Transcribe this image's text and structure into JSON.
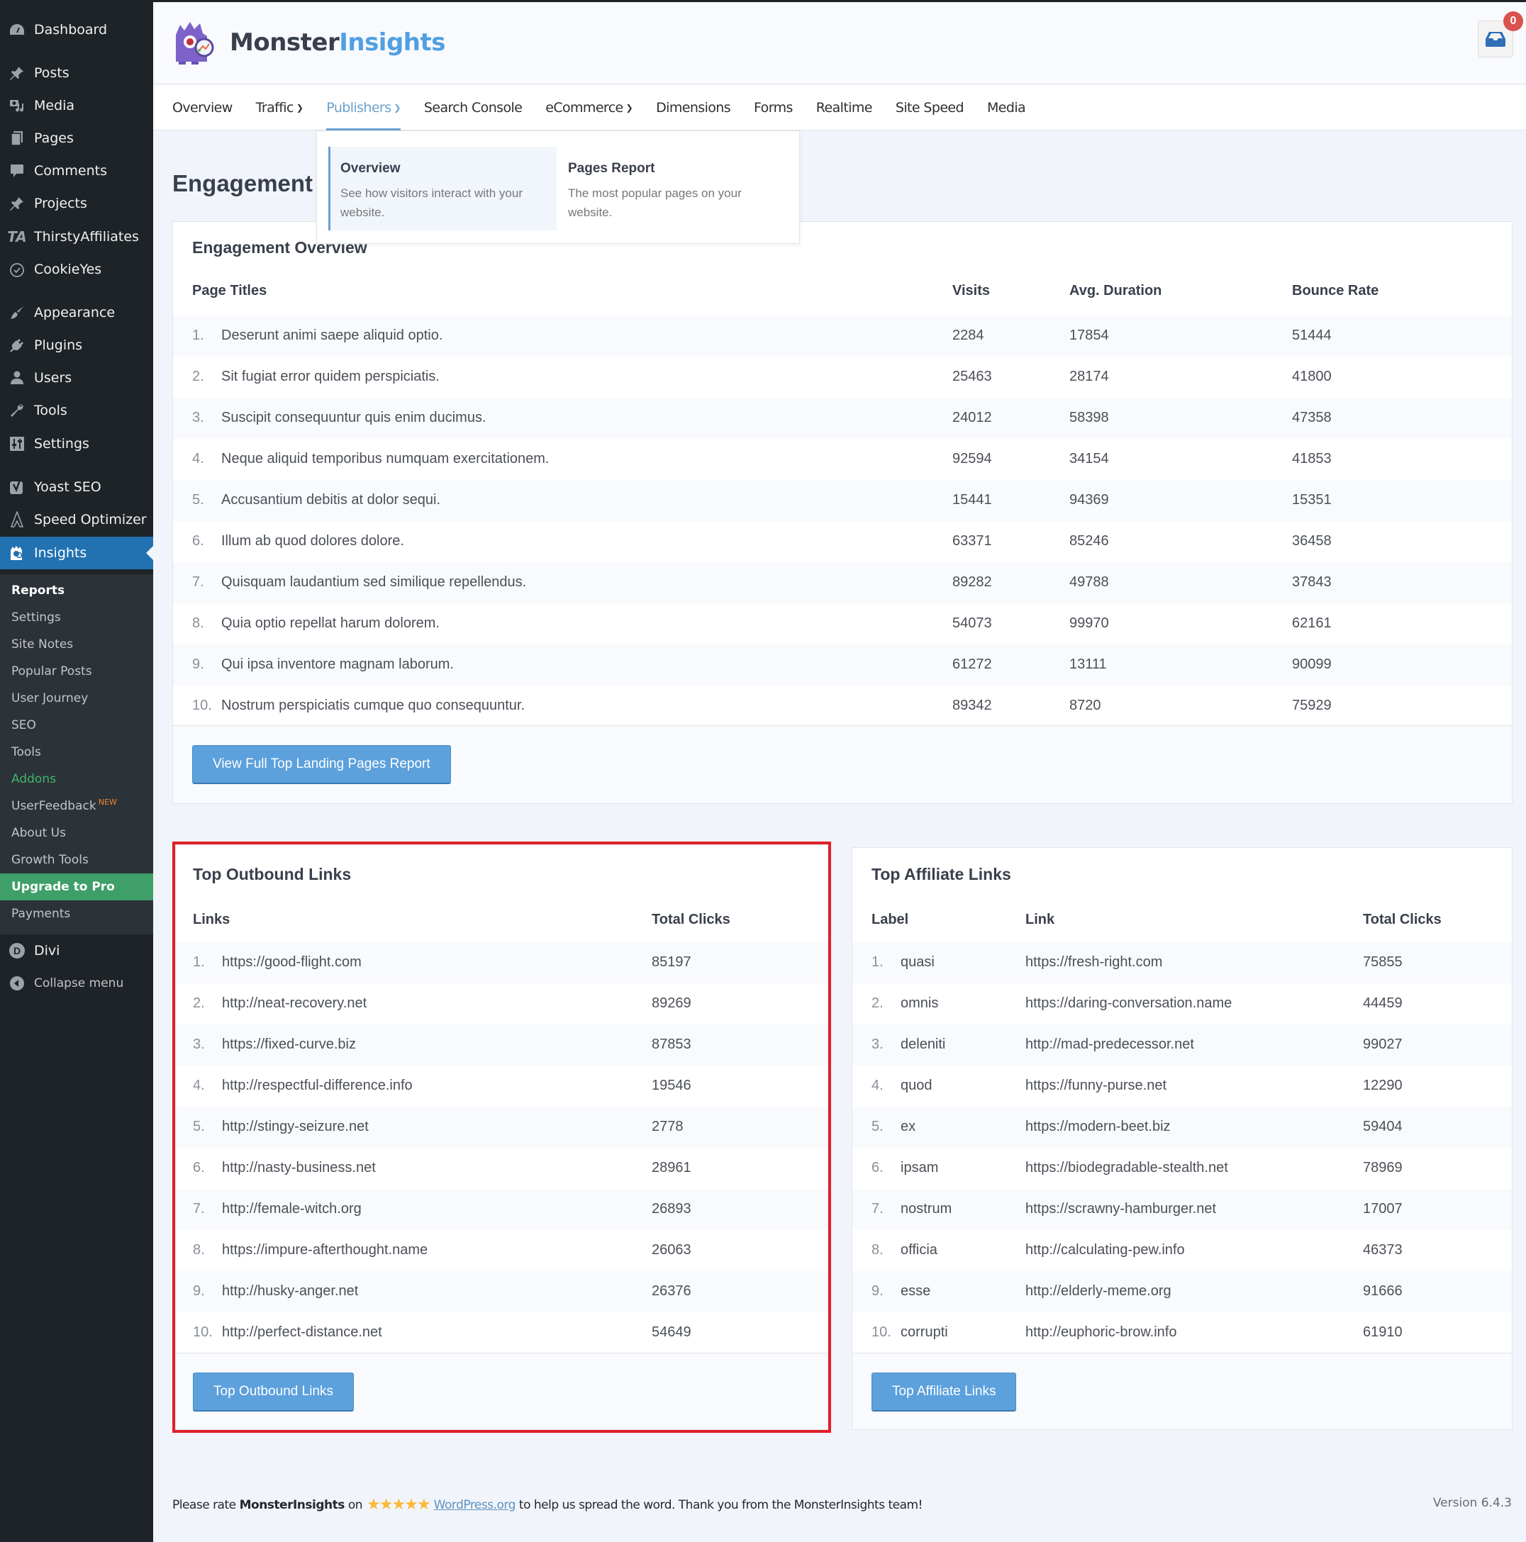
{
  "sidebar": {
    "items": [
      {
        "label": "Dashboard",
        "icon": "dashboard-icon"
      },
      {
        "label": "Posts",
        "icon": "pin-icon"
      },
      {
        "label": "Media",
        "icon": "media-icon"
      },
      {
        "label": "Pages",
        "icon": "pages-icon"
      },
      {
        "label": "Comments",
        "icon": "comment-icon"
      },
      {
        "label": "Projects",
        "icon": "pin-icon"
      },
      {
        "label": "ThirstyAffiliates",
        "icon": "ta-icon"
      },
      {
        "label": "CookieYes",
        "icon": "cookie-icon"
      },
      {
        "label": "Appearance",
        "icon": "brush-icon"
      },
      {
        "label": "Plugins",
        "icon": "plug-icon"
      },
      {
        "label": "Users",
        "icon": "user-icon"
      },
      {
        "label": "Tools",
        "icon": "wrench-icon"
      },
      {
        "label": "Settings",
        "icon": "sliders-icon"
      },
      {
        "label": "Yoast SEO",
        "icon": "yoast-icon"
      },
      {
        "label": "Speed Optimizer",
        "icon": "speed-icon"
      },
      {
        "label": "Insights",
        "icon": "monster-icon"
      }
    ],
    "submenu": [
      "Reports",
      "Settings",
      "Site Notes",
      "Popular Posts",
      "User Journey",
      "SEO",
      "Tools",
      "Addons",
      "UserFeedback",
      "About Us",
      "Growth Tools",
      "Upgrade to Pro",
      "Payments"
    ],
    "new_badge": "NEW",
    "bottom": [
      {
        "label": "Divi",
        "icon": "divi-icon"
      },
      {
        "label": "Collapse menu",
        "icon": "collapse-icon"
      }
    ]
  },
  "header": {
    "brand_part1": "Monster",
    "brand_part2": "Insights",
    "notifications_count": "0"
  },
  "nav": {
    "tabs": [
      {
        "label": "Overview",
        "dropdown": false
      },
      {
        "label": "Traffic",
        "dropdown": true
      },
      {
        "label": "Publishers",
        "dropdown": true,
        "active": true
      },
      {
        "label": "Search Console",
        "dropdown": false
      },
      {
        "label": "eCommerce",
        "dropdown": true
      },
      {
        "label": "Dimensions",
        "dropdown": false
      },
      {
        "label": "Forms",
        "dropdown": false
      },
      {
        "label": "Realtime",
        "dropdown": false
      },
      {
        "label": "Site Speed",
        "dropdown": false
      },
      {
        "label": "Media",
        "dropdown": false
      }
    ],
    "dropdown": [
      {
        "title": "Overview",
        "desc": "See how visitors interact with your website."
      },
      {
        "title": "Pages Report",
        "desc": "The most popular pages on your website."
      }
    ]
  },
  "page": {
    "heading": "Engagement"
  },
  "engagement": {
    "title": "Engagement Overview",
    "columns": [
      "Page Titles",
      "Visits",
      "Avg. Duration",
      "Bounce Rate"
    ],
    "rows": [
      [
        "1.",
        "Deserunt animi saepe aliquid optio.",
        "2284",
        "17854",
        "51444"
      ],
      [
        "2.",
        "Sit fugiat error quidem perspiciatis.",
        "25463",
        "28174",
        "41800"
      ],
      [
        "3.",
        "Suscipit consequuntur quis enim ducimus.",
        "24012",
        "58398",
        "47358"
      ],
      [
        "4.",
        "Neque aliquid temporibus numquam exercitationem.",
        "92594",
        "34154",
        "41853"
      ],
      [
        "5.",
        "Accusantium debitis at dolor sequi.",
        "15441",
        "94369",
        "15351"
      ],
      [
        "6.",
        "Illum ab quod dolores dolore.",
        "63371",
        "85246",
        "36458"
      ],
      [
        "7.",
        "Quisquam laudantium sed similique repellendus.",
        "89282",
        "49788",
        "37843"
      ],
      [
        "8.",
        "Quia optio repellat harum dolorem.",
        "54073",
        "99970",
        "62161"
      ],
      [
        "9.",
        "Qui ipsa inventore magnam laborum.",
        "61272",
        "13111",
        "90099"
      ],
      [
        "10.",
        "Nostrum perspiciatis cumque quo consequuntur.",
        "89342",
        "8720",
        "75929"
      ]
    ],
    "button": "View Full Top Landing Pages Report"
  },
  "outbound": {
    "title": "Top Outbound Links",
    "columns": [
      "Links",
      "Total Clicks"
    ],
    "rows": [
      [
        "1.",
        "https://good-flight.com",
        "85197"
      ],
      [
        "2.",
        "http://neat-recovery.net",
        "89269"
      ],
      [
        "3.",
        "https://fixed-curve.biz",
        "87853"
      ],
      [
        "4.",
        "http://respectful-difference.info",
        "19546"
      ],
      [
        "5.",
        "http://stingy-seizure.net",
        "2778"
      ],
      [
        "6.",
        "http://nasty-business.net",
        "28961"
      ],
      [
        "7.",
        "http://female-witch.org",
        "26893"
      ],
      [
        "8.",
        "https://impure-afterthought.name",
        "26063"
      ],
      [
        "9.",
        "http://husky-anger.net",
        "26376"
      ],
      [
        "10.",
        "http://perfect-distance.net",
        "54649"
      ]
    ],
    "button": "Top Outbound Links"
  },
  "affiliate": {
    "title": "Top Affiliate Links",
    "columns": [
      "Label",
      "Link",
      "Total Clicks"
    ],
    "rows": [
      [
        "1.",
        "quasi",
        "https://fresh-right.com",
        "75855"
      ],
      [
        "2.",
        "omnis",
        "https://daring-conversation.name",
        "44459"
      ],
      [
        "3.",
        "deleniti",
        "http://mad-predecessor.net",
        "99027"
      ],
      [
        "4.",
        "quod",
        "https://funny-purse.net",
        "12290"
      ],
      [
        "5.",
        "ex",
        "https://modern-beet.biz",
        "59404"
      ],
      [
        "6.",
        "ipsam",
        "https://biodegradable-stealth.net",
        "78969"
      ],
      [
        "7.",
        "nostrum",
        "https://scrawny-hamburger.net",
        "17007"
      ],
      [
        "8.",
        "officia",
        "http://calculating-pew.info",
        "46373"
      ],
      [
        "9.",
        "esse",
        "http://elderly-meme.org",
        "91666"
      ],
      [
        "10.",
        "corrupti",
        "http://euphoric-brow.info",
        "61910"
      ]
    ],
    "button": "Top Affiliate Links"
  },
  "footer": {
    "prefix": "Please rate",
    "brand": "MonsterInsights",
    "on": "on",
    "stars": "★★★★★",
    "link": "WordPress.org",
    "suffix": "to help us spread the word. Thank you from the MonsterInsights team!",
    "version": "Version 6.4.3"
  },
  "colors": {
    "accent": "#509fe2",
    "sidebar_bg": "#1d2327",
    "active_menu": "#2271b1",
    "upgrade": "#3e9f68",
    "highlight": "#e0202a",
    "button": "#5ca0dc"
  }
}
